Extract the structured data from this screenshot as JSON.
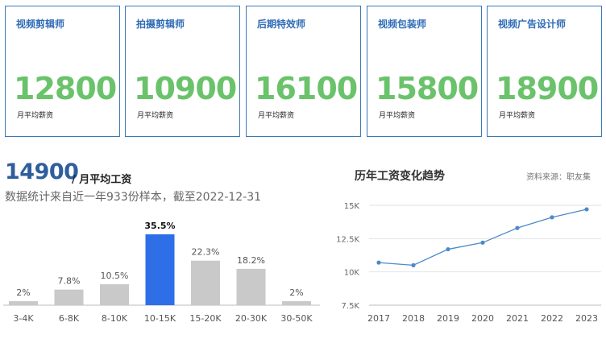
{
  "cards": [
    {
      "title": "视频剪辑师",
      "value": "12800",
      "sub": "月平均薪资"
    },
    {
      "title": "拍摄剪辑师",
      "value": "10900",
      "sub": "月平均薪资"
    },
    {
      "title": "后期特效师",
      "value": "16100",
      "sub": "月平均薪资"
    },
    {
      "title": "视频包装师",
      "value": "15800",
      "sub": "月平均薪资"
    },
    {
      "title": "视频广告设计师",
      "value": "18900",
      "sub": "月平均薪资"
    }
  ],
  "summary": {
    "value": "14900",
    "unit": "/ 月平均工资",
    "note": "数据统计来自近一年933份样本，截至2022-12-31"
  },
  "colors": {
    "card_border": "#3b78b8",
    "card_title": "#2f6cb5",
    "card_value": "#6ac36a",
    "bar_default": "#c9c9c9",
    "bar_highlight": "#2e6fe8",
    "line": "#4b8ac8"
  },
  "chart_data": [
    {
      "type": "bar",
      "categories": [
        "3-4K",
        "6-8K",
        "8-10K",
        "10-15K",
        "15-20K",
        "20-30K",
        "30-50K"
      ],
      "values": [
        2,
        7.8,
        10.5,
        35.5,
        22.3,
        18.2,
        2
      ],
      "data_labels": [
        "2%",
        "7.8%",
        "10.5%",
        "35.5%",
        "22.3%",
        "18.2%",
        "2%"
      ],
      "highlight_index": 3,
      "ylim": [
        0,
        35.5
      ]
    },
    {
      "type": "line",
      "title": "历年工资变化趋势",
      "source": "资料来源：职友集",
      "x": [
        "2017",
        "2018",
        "2019",
        "2020",
        "2021",
        "2022",
        "2023"
      ],
      "y": [
        10700,
        10500,
        11700,
        12200,
        13300,
        14100,
        14700
      ],
      "yticks": [
        7500,
        10000,
        12500,
        15000
      ],
      "ytick_labels": [
        "7.5K",
        "10K",
        "12.5K",
        "15K"
      ],
      "ylim": [
        7500,
        15000
      ],
      "grid": true
    }
  ]
}
